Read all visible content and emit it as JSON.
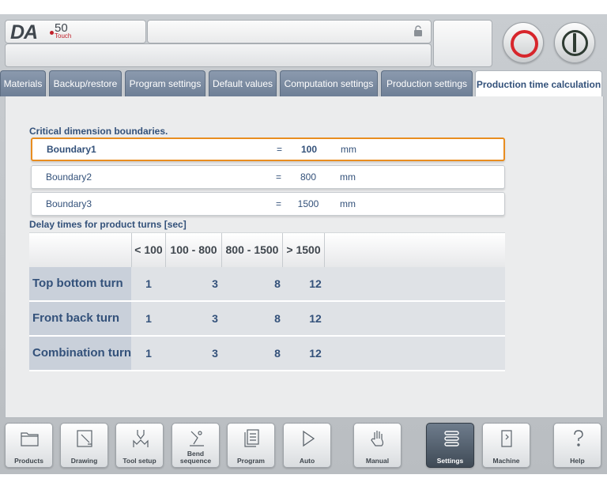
{
  "header": {
    "logo_brand": "DA",
    "logo_model": "50",
    "logo_suffix": "Touch",
    "message": "",
    "status": ""
  },
  "tabs": [
    {
      "label": "Materials"
    },
    {
      "label": "Backup/restore"
    },
    {
      "label": "Program settings"
    },
    {
      "label": "Default values"
    },
    {
      "label": "Computation settings"
    },
    {
      "label": "Production settings"
    },
    {
      "label": "Production time calculation",
      "active": true
    }
  ],
  "boundaries": {
    "title": "Critical dimension boundaries.",
    "rows": [
      {
        "name": "Boundary1",
        "eq": "=",
        "value": "100",
        "unit": "mm",
        "selected": true
      },
      {
        "name": "Boundary2",
        "eq": "=",
        "value": "800",
        "unit": "mm"
      },
      {
        "name": "Boundary3",
        "eq": "=",
        "value": "1500",
        "unit": "mm"
      }
    ]
  },
  "delays": {
    "title": "Delay times for product turns [sec]",
    "columns": [
      "< 100",
      "100 - 800",
      "800 - 1500",
      "> 1500"
    ],
    "rows": [
      {
        "label": "Top bottom turn",
        "values": [
          "1",
          "3",
          "8",
          "12"
        ]
      },
      {
        "label": "Front back turn",
        "values": [
          "1",
          "3",
          "8",
          "12"
        ]
      },
      {
        "label": "Combination turn",
        "values": [
          "1",
          "3",
          "8",
          "12"
        ]
      }
    ]
  },
  "nav": [
    {
      "label": "Products",
      "icon": "folder-icon"
    },
    {
      "label": "Drawing",
      "icon": "drawing-icon"
    },
    {
      "label": "Tool setup",
      "icon": "tool-icon"
    },
    {
      "label": "Bend sequence",
      "icon": "bend-sequence-icon"
    },
    {
      "label": "Program",
      "icon": "program-icon"
    },
    {
      "label": "Auto",
      "icon": "play-icon"
    },
    {
      "label": "Manual",
      "icon": "hand-icon"
    },
    {
      "label": "Settings",
      "icon": "settings-list-icon",
      "active": true
    },
    {
      "label": "Machine",
      "icon": "machine-icon"
    },
    {
      "label": "Help",
      "icon": "help-icon"
    }
  ],
  "colors": {
    "accent_selected": "#e88d20",
    "label_blue": "#33517a",
    "stop_red": "#d7262c"
  }
}
